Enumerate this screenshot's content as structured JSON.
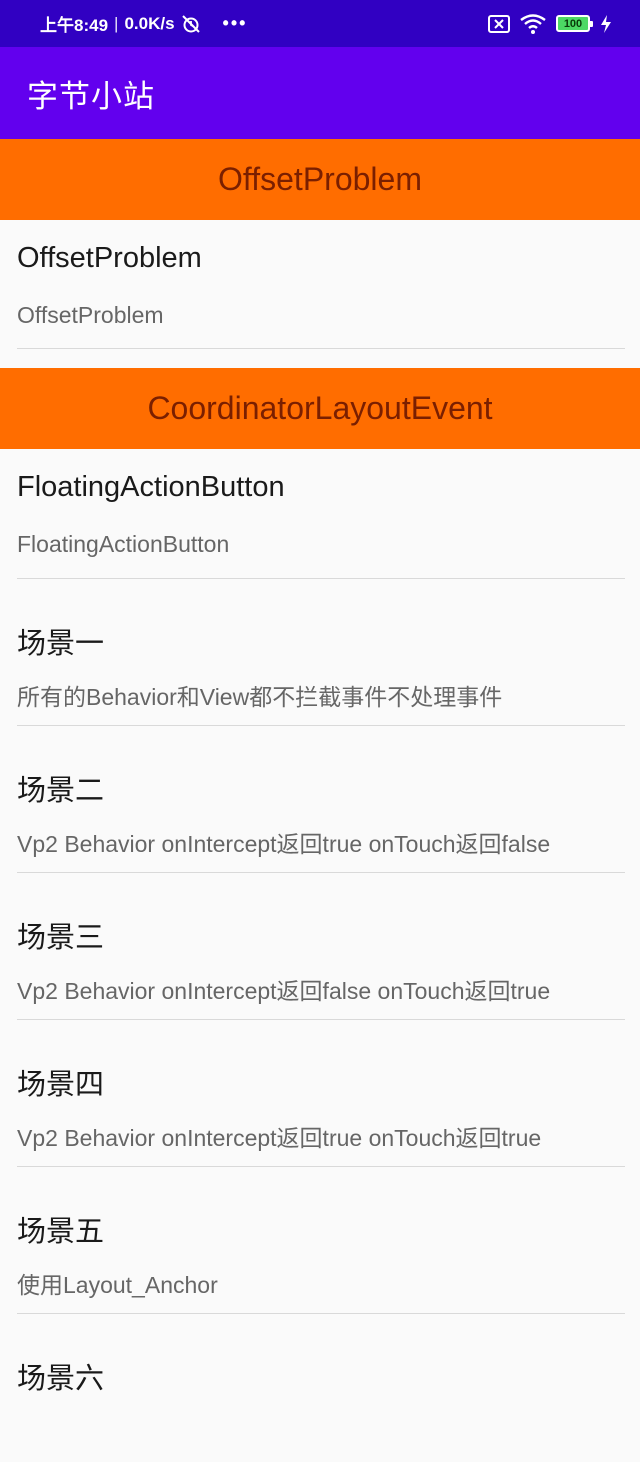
{
  "status_bar": {
    "time": "上午8:49",
    "separator": "|",
    "speed": "0.0K/s",
    "more": "•••",
    "battery": "100"
  },
  "app_bar": {
    "title": "字节小站"
  },
  "sections": [
    {
      "header": "OffsetProblem",
      "items": [
        {
          "title": "OffsetProblem",
          "subtitle": "OffsetProblem"
        }
      ]
    },
    {
      "header": "CoordinatorLayoutEvent",
      "items": [
        {
          "title": "FloatingActionButton",
          "subtitle": "FloatingActionButton"
        },
        {
          "title": "场景一",
          "subtitle": "所有的Behavior和View都不拦截事件不处理事件"
        },
        {
          "title": "场景二",
          "subtitle": "Vp2 Behavior onIntercept返回true onTouch返回false"
        },
        {
          "title": "场景三",
          "subtitle": "Vp2 Behavior onIntercept返回false onTouch返回true"
        },
        {
          "title": "场景四",
          "subtitle": "Vp2 Behavior onIntercept返回true onTouch返回true"
        },
        {
          "title": "场景五",
          "subtitle": "使用Layout_Anchor"
        },
        {
          "title": "场景六",
          "subtitle": ""
        }
      ]
    }
  ],
  "colors": {
    "status_bar": "#3100c2",
    "app_bar": "#6200ee",
    "section_header_bg": "#ff6d00",
    "section_header_text": "#7a1f00",
    "battery": "#4cd964"
  }
}
